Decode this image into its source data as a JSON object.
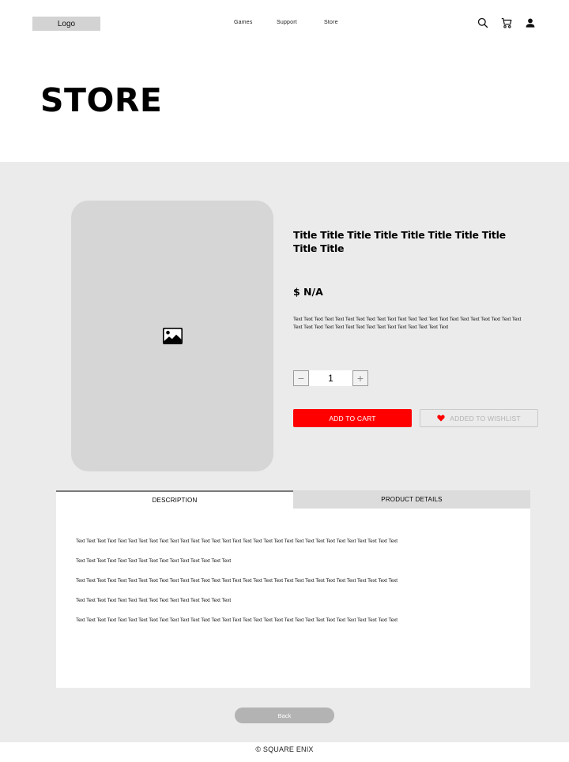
{
  "header": {
    "logo": "Logo",
    "nav": [
      "Games",
      "Support",
      "Store"
    ],
    "icons": [
      "search-icon",
      "cart-icon",
      "user-icon"
    ]
  },
  "page_title": "STORE",
  "product": {
    "image_icon": "image-placeholder-icon",
    "title": "Title Title Title Title Title Title Title Title Title Title",
    "price": "$  N/A",
    "description": "Text Text Text Text Text Text Text Text Text Text Text Text Text Text Text Text Text Text Text Text Text Text Text Text Text Text Text Text Text Text Text Text Text Text Text Text Text",
    "quantity": "1",
    "qty_minus": "−",
    "qty_plus": "+",
    "add_to_cart": "ADD TO CART",
    "wishlist": "ADDED TO WISHLIST"
  },
  "tabs": [
    {
      "label": "DESCRIPTION",
      "active": true
    },
    {
      "label": "PRODUCT DETAILS",
      "active": false
    }
  ],
  "tab_content": {
    "lines": [
      "Text Text Text Text Text Text Text Text Text Text Text Text Text Text Text Text Text Text Text Text Text Text Text Text Text Text Text Text Text Text Text",
      "Text Text Text Text Text Text Text Text Text Text Text Text Text Text Text",
      "Text Text Text Text Text Text Text Text Text Text Text Text Text Text Text Text Text Text Text Text Text Text Text Text Text Text Text Text Text Text Text",
      "Text Text Text Text Text Text Text Text Text Text Text Text Text Text Text",
      "Text Text Text Text Text Text Text Text Text Text Text Text Text Text Text Text Text Text Text Text Text Text Text Text Text Text Text Text Text Text Text"
    ]
  },
  "back_button": "Back",
  "footer": "© SQUARE ENIX",
  "colors": {
    "accent": "#ff0000",
    "section_bg": "#ebebeb",
    "placeholder": "#d6d6d6"
  }
}
